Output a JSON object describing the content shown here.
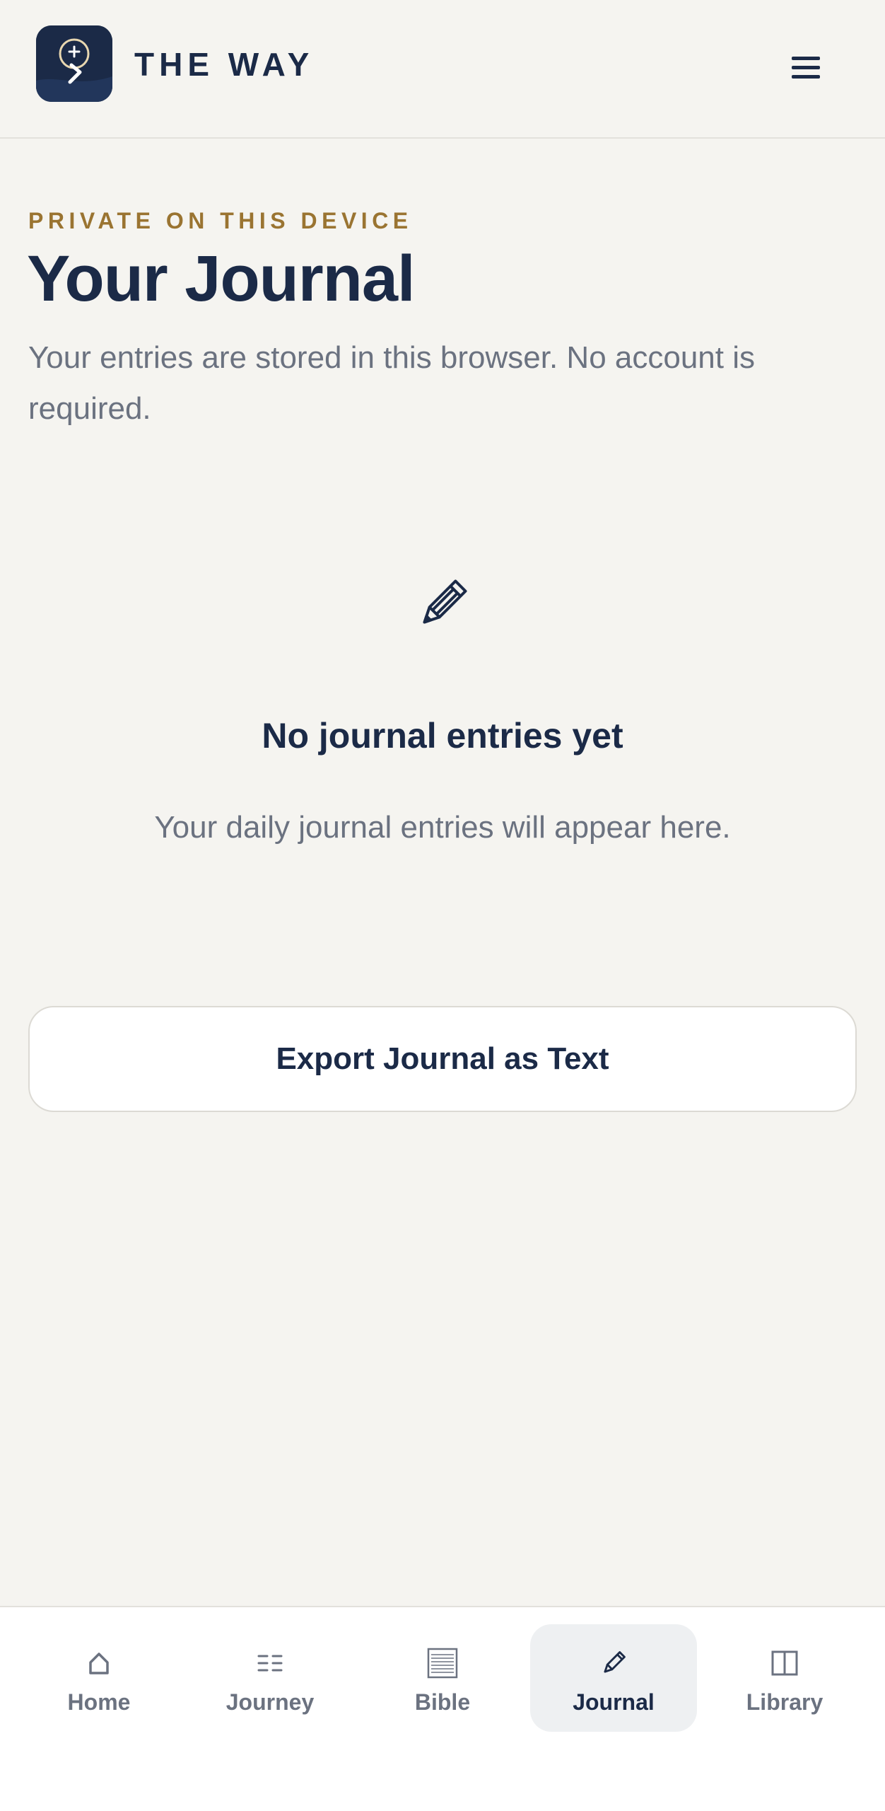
{
  "header": {
    "brand": "THE WAY",
    "logo_icon": "compass-path-logo-icon",
    "menu_icon": "hamburger-menu-icon"
  },
  "intro": {
    "eyebrow": "PRIVATE ON THIS DEVICE",
    "title": "Your Journal",
    "subtitle": "Your entries are stored in this browser. No account is required."
  },
  "empty_state": {
    "icon": "pencil-icon",
    "title": "No journal entries yet",
    "text": "Your daily journal entries will appear here."
  },
  "actions": {
    "export_label": "Export Journal as Text"
  },
  "bottom_nav": {
    "items": [
      {
        "label": "Home",
        "icon": "home-icon",
        "active": false
      },
      {
        "label": "Journey",
        "icon": "list-icon",
        "active": false
      },
      {
        "label": "Bible",
        "icon": "book-icon",
        "active": false
      },
      {
        "label": "Journal",
        "icon": "pencil-icon",
        "active": true
      },
      {
        "label": "Library",
        "icon": "library-icon",
        "active": false
      }
    ]
  },
  "colors": {
    "background": "#f5f4f0",
    "navy": "#1b2a47",
    "gold": "#9a7431",
    "muted": "#6b7280",
    "active_tab_bg": "#eef0f2"
  }
}
